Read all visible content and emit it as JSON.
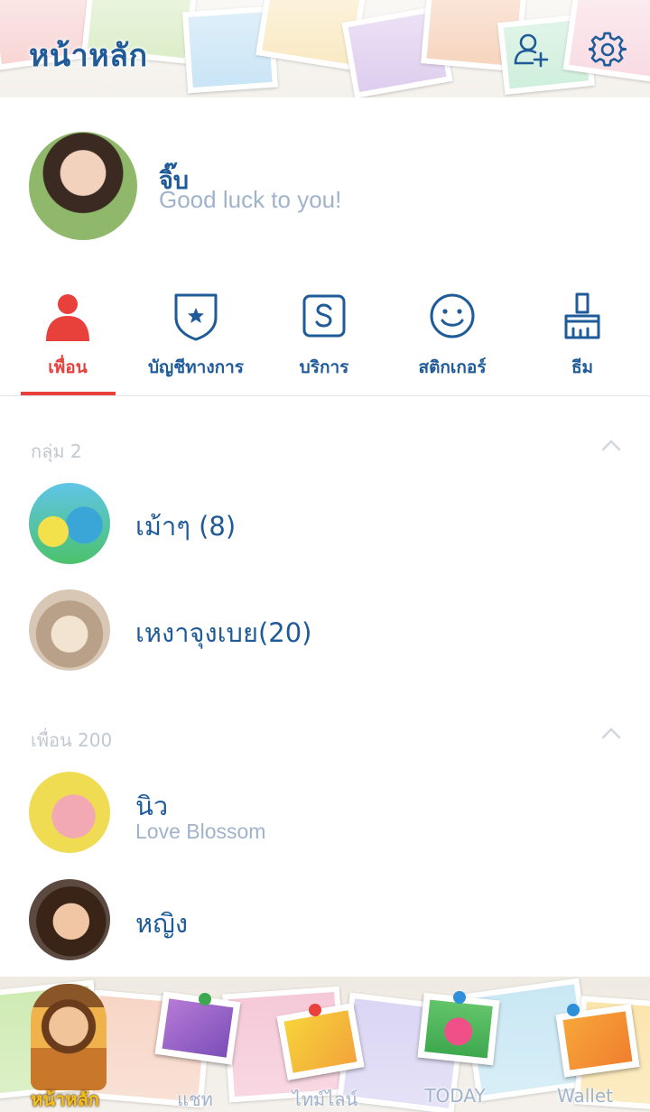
{
  "header": {
    "title": "หน้าหลัก",
    "add_friend_icon": "add-friend-icon",
    "settings_icon": "gear-icon"
  },
  "profile": {
    "name": "จิ๊บ",
    "status": "Good luck to you!"
  },
  "tabs": [
    {
      "label": "เพื่อน",
      "icon": "person-icon",
      "active": true
    },
    {
      "label": "บัญชีทางการ",
      "icon": "shield-star-icon",
      "active": false
    },
    {
      "label": "บริการ",
      "icon": "service-s-icon",
      "active": false
    },
    {
      "label": "สติกเกอร์",
      "icon": "smiley-icon",
      "active": false
    },
    {
      "label": "ธีม",
      "icon": "paint-brush-icon",
      "active": false
    }
  ],
  "groups": {
    "header": "กลุ่ม 2",
    "items": [
      {
        "name": "เม้าๆ (8)"
      },
      {
        "name": "เหงาจุงเบย(20)"
      }
    ]
  },
  "friends": {
    "header": "เพื่อน 200",
    "items": [
      {
        "name": "นิว",
        "status": "Love Blossom"
      },
      {
        "name": "หญิง",
        "status": ""
      }
    ]
  },
  "bottom_nav": [
    {
      "label": "หน้าหลัก",
      "active": true
    },
    {
      "label": "แชท",
      "active": false
    },
    {
      "label": "ไทม์ไลน์",
      "active": false
    },
    {
      "label": "TODAY",
      "active": false
    },
    {
      "label": "Wallet",
      "active": false
    }
  ],
  "colors": {
    "accent_blue": "#1f5b99",
    "active_red": "#e8403a",
    "subtle_text": "#9fb3cb",
    "section_gray": "#c2c8d0",
    "nav_active_yellow": "#f1c21b"
  }
}
